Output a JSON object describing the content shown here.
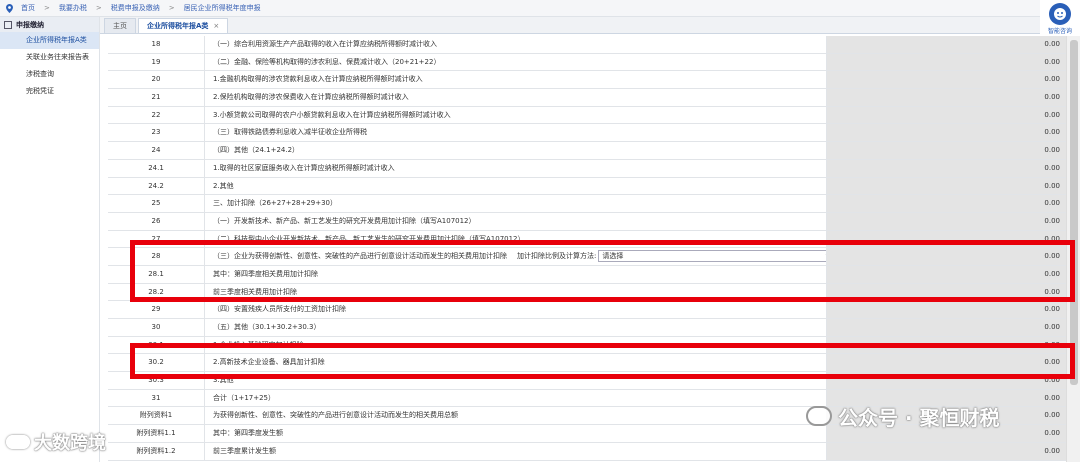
{
  "breadcrumb": [
    "首页",
    "我要办税",
    "税费申报及缴纳",
    "居民企业所得税年度申报"
  ],
  "breadcrumb_sep": ">",
  "sidebar": {
    "title": "申报缴纳",
    "items": [
      "企业所得税年报A类",
      "关联业务往来报告表",
      "涉税查询",
      "完税凭证"
    ]
  },
  "tabs": [
    {
      "label": "主页"
    },
    {
      "label": "企业所得税年报A类",
      "close": "×"
    }
  ],
  "helper_label": "智能咨询",
  "rows": [
    {
      "no": "18",
      "desc": "（一）综合利用资源生产产品取得的收入在计算应纳税所得额时减计收入",
      "amt": "0.00"
    },
    {
      "no": "19",
      "desc": "（二）金融、保险等机构取得的涉农利息、保费减计收入（20+21+22）",
      "amt": "0.00"
    },
    {
      "no": "20",
      "desc": "1.金融机构取得的涉农贷款利息收入在计算应纳税所得额时减计收入",
      "amt": "0.00"
    },
    {
      "no": "21",
      "desc": "2.保险机构取得的涉农保费收入在计算应纳税所得额时减计收入",
      "amt": "0.00"
    },
    {
      "no": "22",
      "desc": "3.小额贷款公司取得的农户小额贷款利息收入在计算应纳税所得额时减计收入",
      "amt": "0.00"
    },
    {
      "no": "23",
      "desc": "（三）取得铁路债券利息收入减半征收企业所得税",
      "amt": "0.00"
    },
    {
      "no": "24",
      "desc": "（四）其他（24.1+24.2）",
      "amt": "0.00"
    },
    {
      "no": "24.1",
      "desc": "1.取得的社区家庭服务收入在计算应纳税所得额时减计收入",
      "amt": "0.00"
    },
    {
      "no": "24.2",
      "desc": "2.其他",
      "amt": "0.00"
    },
    {
      "no": "25",
      "desc": "三、加计扣除（26+27+28+29+30）",
      "amt": "0.00"
    },
    {
      "no": "26",
      "desc": "（一）开发新技术、新产品、新工艺发生的研究开发费用加计扣除（填写A107012）",
      "amt": "0.00"
    },
    {
      "no": "27",
      "desc": "（二）科技型中小企业开发新技术、新产品、新工艺发生的研究开发费用加计扣除（填写A107012）",
      "amt": "0.00"
    },
    {
      "no": "28",
      "desc": "（三）企业为获得创新性、创意性、突破性的产品进行创意设计活动而发生的相关费用加计扣除",
      "amt": "0.00",
      "select_label": "加计扣除比例及计算方法:",
      "select_value": "请选择"
    },
    {
      "no": "28.1",
      "desc": "其中：第四季度相关费用加计扣除",
      "amt": "0.00"
    },
    {
      "no": "28.2",
      "desc": "前三季度相关费用加计扣除",
      "amt": "0.00"
    },
    {
      "no": "29",
      "desc": "（四）安置残疾人员所支付的工资加计扣除",
      "amt": "0.00"
    },
    {
      "no": "30",
      "desc": "（五）其他（30.1+30.2+30.3）",
      "amt": "0.00"
    },
    {
      "no": "30.1",
      "desc": "1.企业投入基础研究加计扣除",
      "amt": "0.00"
    },
    {
      "no": "30.2",
      "desc": "2.高新技术企业设备、器具加计扣除",
      "amt": "0.00"
    },
    {
      "no": "30.3",
      "desc": "3.其他",
      "amt": "0.00"
    },
    {
      "no": "31",
      "desc": "合计（1+17+25）",
      "amt": "0.00"
    },
    {
      "no": "附列资料1",
      "desc": "为获得创新性、创意性、突破性的产品进行创意设计活动而发生的相关费用总额",
      "amt": "0.00"
    },
    {
      "no": "附列资料1.1",
      "desc": "其中：第四季度发生额",
      "amt": "0.00"
    },
    {
      "no": "附列资料1.2",
      "desc": "前三季度累计发生额",
      "amt": "0.00"
    }
  ],
  "watermark_right": "公众号 · 聚恒财税",
  "watermark_left": "大数跨境",
  "colors": {
    "highlight": "#e8000b",
    "accent": "#2a5fb8"
  }
}
